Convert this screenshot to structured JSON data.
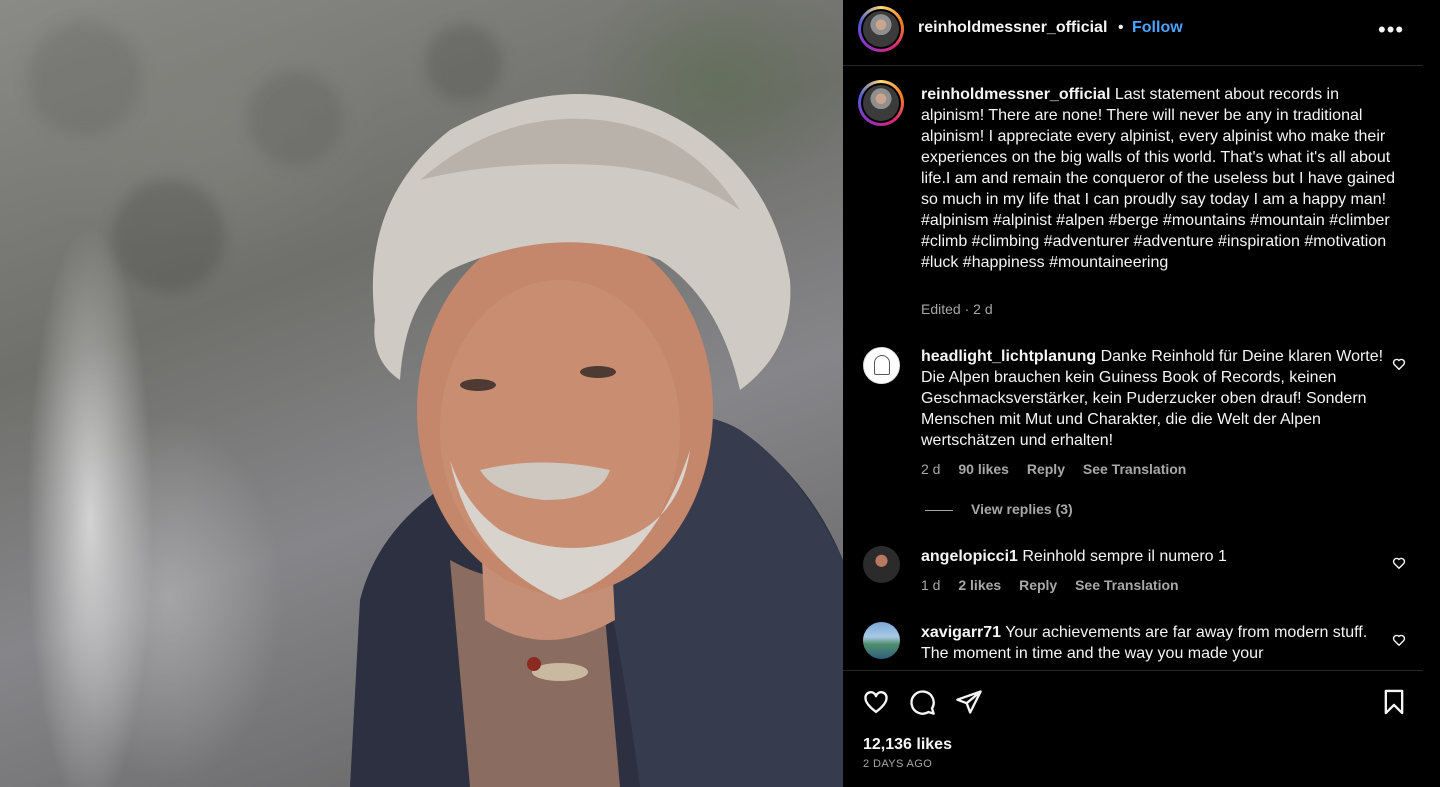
{
  "post": {
    "username": "reinholdmessner_official",
    "separator": "•",
    "follow_label": "Follow",
    "more_icon": "more-horizontal-icon",
    "caption": "Last statement about records in alpinism! There are none! There will never be any in traditional alpinism! I appreciate every alpinist, every alpinist who make their experiences on the big walls of this world. That's what it's all about life.I am and remain the conqueror of the useless but I have gained so much in my life that I can proudly say today I am a happy man! #alpinism #alpinist #alpen #berge #mountains #mountain #climber #climb #climbing #adventurer #adventure #inspiration #motivation #luck #happiness #mountaineering",
    "caption_meta": "Edited · 2 d"
  },
  "comments": [
    {
      "username": "headlight_lichtplanung",
      "text": "Danke Reinhold für Deine klaren Worte! Die Alpen brauchen kein Guiness Book of Records, keinen Geschmacksverstärker, kein Puderzucker oben drauf! Sondern Menschen mit Mut und Charakter, die die Welt der Alpen wertschätzen und erhalten!",
      "time": "2 d",
      "likes": "90 likes",
      "reply": "Reply",
      "translate": "See Translation",
      "view_replies": "View replies (3)"
    },
    {
      "username": "angelopicci1",
      "text": "Reinhold sempre il numero 1",
      "time": "1 d",
      "likes": "2 likes",
      "reply": "Reply",
      "translate": "See Translation"
    },
    {
      "username": "xavigarr71",
      "text": "Your achievements are far away from modern stuff. The moment in time and the way you made your"
    }
  ],
  "footer": {
    "likes": "12,136 likes",
    "timestamp": "2 DAYS AGO"
  },
  "colors": {
    "background": "#000000",
    "text": "#f5f5f5",
    "muted": "#a8a8a8",
    "follow": "#4aa3ff"
  }
}
